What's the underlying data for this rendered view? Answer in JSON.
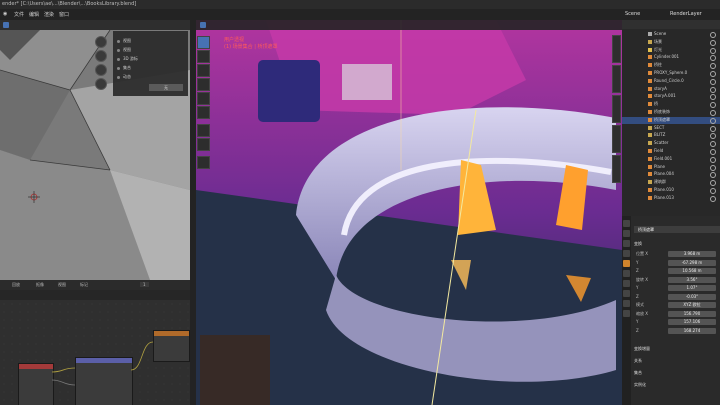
{
  "title": "ender* [C:\\Users\\ae\\...\\Blender\\...\\BooksLibrary.blend]",
  "menubar": {
    "items": [
      "文件",
      "编辑",
      "渲染",
      "窗口",
      "帮助"
    ]
  },
  "workspaces": [
    "Layout",
    "Modeling",
    "Sculpting",
    "UV Editing",
    "Texture Paint",
    "Shading",
    "Animation",
    "Rendering",
    "Compositing",
    "Scripting",
    "Geometry Nodes"
  ],
  "scene": {
    "label": "Scene",
    "view_layer": "RenderLayer"
  },
  "left_panel": {
    "items": [
      "视图",
      "视图",
      "3D 游标",
      "集合",
      "动态",
      "视图属性"
    ],
    "field_value": "无"
  },
  "timeline": {
    "items": [
      "回放",
      "抠像",
      "视图",
      "标记"
    ],
    "frame": "1"
  },
  "viewport": {
    "info_line1": "用户透视",
    "info_line2": "(1) 场景集合 | 桥顶遮罩"
  },
  "outliner": {
    "rows": [
      {
        "label": "Scene",
        "color": "#aaaaaa"
      },
      {
        "label": "场景",
        "color": "#c8a850"
      },
      {
        "label": "灯光",
        "color": "#e0c050"
      },
      {
        "label": "Cylinder.001",
        "color": "#e08a3a"
      },
      {
        "label": "桥柱",
        "color": "#e08a3a"
      },
      {
        "label": "PROXY_Sphere.0",
        "color": "#e08a3a"
      },
      {
        "label": "Round_Circle.0",
        "color": "#e08a3a"
      },
      {
        "label": "storyA",
        "color": "#e08a3a"
      },
      {
        "label": "storyA.001",
        "color": "#e08a3a"
      },
      {
        "label": "桥",
        "color": "#e08a3a"
      },
      {
        "label": "桥底装饰",
        "color": "#e08a3a"
      },
      {
        "label": "桥顶遮罩",
        "color": "#e08a3a"
      },
      {
        "label": "SECT",
        "color": "#c8a850"
      },
      {
        "label": "BLITZ",
        "color": "#c8a850"
      },
      {
        "label": "Scatter",
        "color": "#c8a850"
      },
      {
        "label": "Field",
        "color": "#e08a3a"
      },
      {
        "label": "Field.001",
        "color": "#e08a3a"
      },
      {
        "label": "Plane",
        "color": "#e08a3a"
      },
      {
        "label": "Plane.004",
        "color": "#e08a3a"
      },
      {
        "label": "建筑群",
        "color": "#c8a850"
      },
      {
        "label": "Plane.010",
        "color": "#e08a3a"
      },
      {
        "label": "Plane.013",
        "color": "#e08a3a"
      }
    ],
    "selected_index": 11
  },
  "properties": {
    "object_name": "桥顶遮罩",
    "section": "变换",
    "fields": [
      {
        "label": "位置 X",
        "value": "3.968 m"
      },
      {
        "label": "Y",
        "value": "-67.298 m"
      },
      {
        "label": "Z",
        "value": "10.568 m"
      },
      {
        "label": "旋转 X",
        "value": "3.56°"
      },
      {
        "label": "Y",
        "value": "1.07°"
      },
      {
        "label": "Z",
        "value": "-0.03°"
      },
      {
        "label": "模式",
        "value": "XYZ 欧拉"
      },
      {
        "label": "缩放 X",
        "value": "156.790"
      },
      {
        "label": "Y",
        "value": "157.106"
      },
      {
        "label": "Z",
        "value": "168.274"
      }
    ],
    "collapsed": [
      "变换增量",
      "关系",
      "集合",
      "实例化"
    ]
  }
}
